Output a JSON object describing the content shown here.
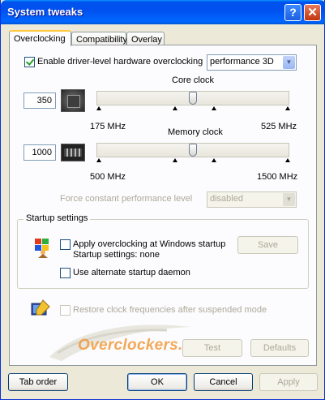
{
  "window": {
    "title": "System tweaks",
    "help_symbol": "?",
    "close_symbol": "✕"
  },
  "tabs": [
    {
      "label": "Overclocking",
      "active": true
    },
    {
      "label": "Compatibility",
      "active": false
    },
    {
      "label": "Overlay",
      "active": false
    }
  ],
  "overclocking": {
    "enable_label": "Enable driver-level hardware overclocking",
    "enable_checked": true,
    "mode_value": "performance 3D",
    "core": {
      "title": "Core clock",
      "value": "350",
      "min_label": "175 MHz",
      "max_label": "525 MHz",
      "slider_fraction": 0.5
    },
    "memory": {
      "title": "Memory clock",
      "value": "1000",
      "min_label": "500 MHz",
      "max_label": "1500 MHz",
      "slider_fraction": 0.5
    },
    "force_label": "Force constant performance level",
    "force_value": "disabled"
  },
  "startup": {
    "group_title": "Startup settings",
    "apply_label": "Apply overclocking at Windows startup",
    "apply_checked": false,
    "settings_status": "Startup settings: none",
    "save_button": "Save",
    "daemon_label": "Use alternate startup daemon",
    "daemon_checked": false
  },
  "restore_label": "Restore clock frequencies after suspended mode",
  "test_button": "Test",
  "defaults_button": "Defaults",
  "watermark": "Overclockers.ru",
  "footer": {
    "tab_order": "Tab order",
    "ok": "OK",
    "cancel": "Cancel",
    "apply": "Apply"
  }
}
